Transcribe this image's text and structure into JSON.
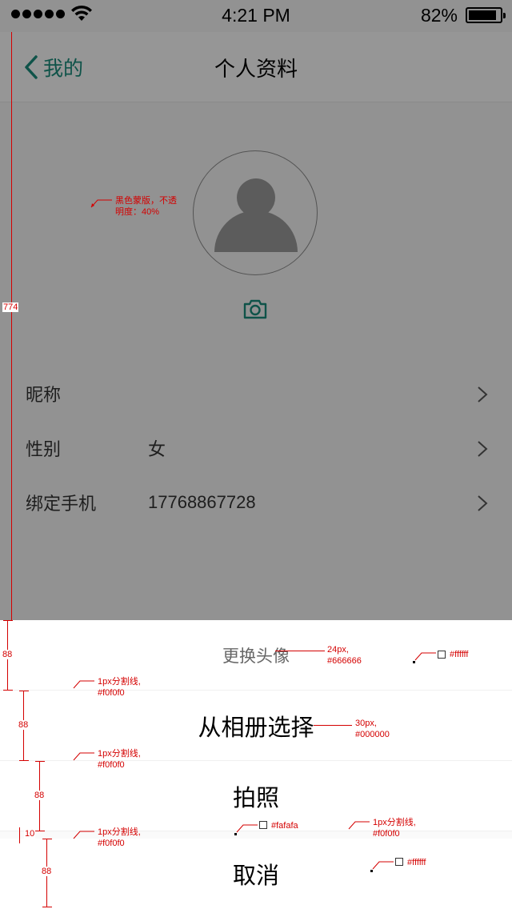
{
  "status_bar": {
    "time": "4:21 PM",
    "battery_percent": "82%",
    "battery_level": 0.82
  },
  "nav": {
    "back_label": "我的",
    "title": "个人资料"
  },
  "profile": {
    "rows": [
      {
        "label": "昵称",
        "value": ""
      },
      {
        "label": "性别",
        "value": "女"
      },
      {
        "label": "绑定手机",
        "value": "17768867728"
      }
    ]
  },
  "action_sheet": {
    "title": "更换头像",
    "choose_album": "从相册选择",
    "take_photo": "拍照",
    "cancel": "取消"
  },
  "annotations": {
    "overlay_note_1": "黑色蒙版，不透",
    "overlay_note_2": "明度：40%",
    "overlay_height": "774",
    "title_spec_1": "24px,",
    "title_spec_2": "#666666",
    "white_color_1": "#ffffff",
    "white_color_2": "#ffffff",
    "btn_spec_1": "30px,",
    "btn_spec_2": "#000000",
    "divider_1a": "1px分割线,",
    "divider_1b": "#f0f0f0",
    "divider_2a": "1px分割线,",
    "divider_2b": "#f0f0f0",
    "divider_3a": "1px分割线,",
    "divider_3b": "#f0f0f0",
    "divider_4a": "1px分割线,",
    "divider_4b": "#f0f0f0",
    "gap_color": "#fafafa",
    "h1": "88",
    "h2": "88",
    "h3": "88",
    "h4": "88",
    "gap": "10"
  },
  "colors": {
    "accent": "#1a8a7a",
    "overlay": "rgba(0,0,0,0.4)",
    "annotation": "#d40000"
  }
}
